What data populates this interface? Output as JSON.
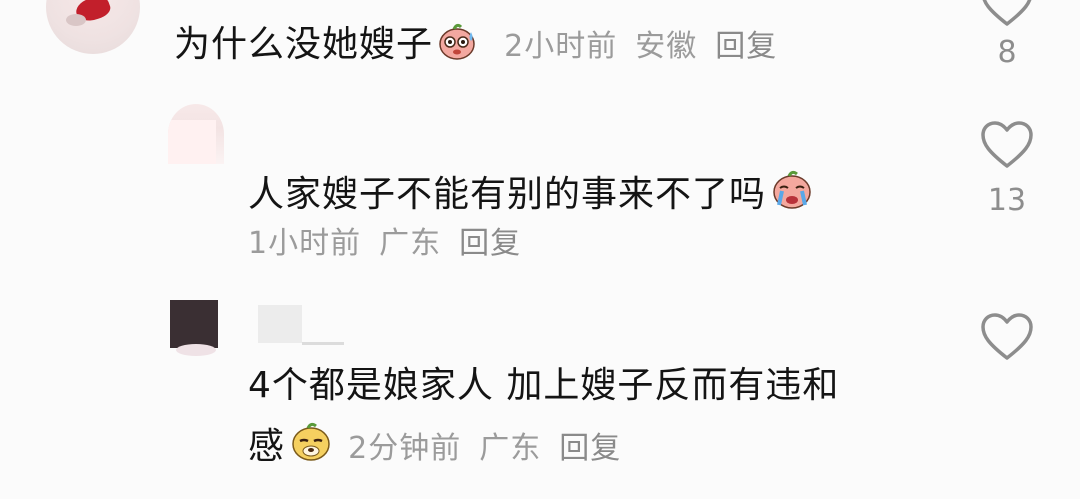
{
  "comments": [
    {
      "text": "为什么没她嫂子",
      "emoji": "sweating-face-emoji",
      "time": "2小时前",
      "location": "安徽",
      "reply_label": "回复",
      "likes": "8"
    },
    {
      "text": "人家嫂子不能有别的事来不了吗",
      "emoji": "crying-face-emoji",
      "time": "1小时前",
      "location": "广东",
      "reply_label": "回复",
      "likes": "13"
    },
    {
      "text_line1": "4个都是娘家人  加上嫂子反而有违和",
      "text_line2": "感",
      "emoji": "smirking-face-emoji",
      "time": "2分钟前",
      "location": "广东",
      "reply_label": "回复",
      "likes": ""
    }
  ],
  "colors": {
    "background": "#fbfbfb",
    "text": "#141414",
    "meta": "#9b9b9b",
    "icon": "#8d8d8d"
  }
}
